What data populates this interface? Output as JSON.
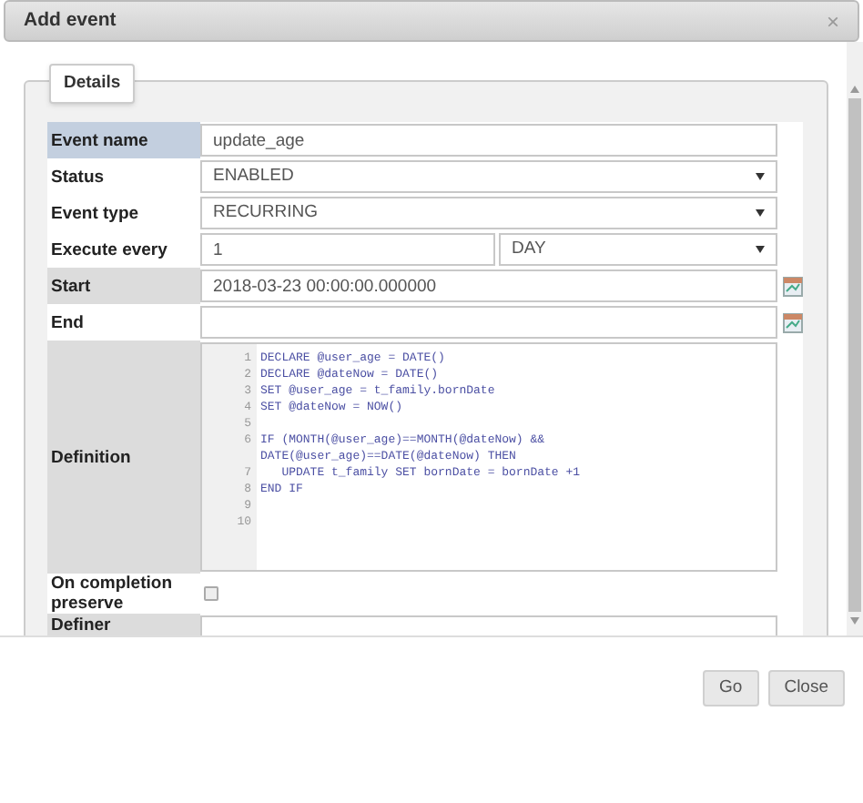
{
  "window": {
    "title": "Add event",
    "close": "×"
  },
  "legend": "Details",
  "rows": [
    {
      "kind": "text",
      "label": "Event name",
      "highlighted": true,
      "shaded": false,
      "value": "update_age"
    },
    {
      "kind": "select",
      "label": "Status",
      "highlighted": false,
      "shaded": false,
      "value": "ENABLED"
    },
    {
      "kind": "select",
      "label": "Event type",
      "highlighted": false,
      "shaded": false,
      "value": "RECURRING"
    },
    {
      "kind": "interval",
      "label": "Execute every",
      "highlighted": false,
      "shaded": false,
      "value": "1",
      "unit": "DAY"
    },
    {
      "kind": "date",
      "label": "Start",
      "highlighted": false,
      "shaded": true,
      "value": "2018-03-23 00:00:00.000000"
    },
    {
      "kind": "date",
      "label": "End",
      "highlighted": false,
      "shaded": false
    },
    {
      "kind": "code",
      "label": "Definition",
      "highlighted": false,
      "shaded": true,
      "lines": [
        {
          "number": "1",
          "text": "DECLARE @user_age = DATE()"
        },
        {
          "number": "2",
          "text": "DECLARE @dateNow = DATE()"
        },
        {
          "number": "3",
          "text": "SET @user_age = t_family.bornDate"
        },
        {
          "number": "4",
          "text": "SET @dateNow = NOW()"
        },
        {
          "number": "5"
        },
        {
          "number": "6",
          "text": "IF (MONTH(@user_age)==MONTH(@dateNow) && DATE(@user_age)==DATE(@dateNow) THEN"
        },
        {
          "number": "7",
          "text": "   UPDATE t_family SET bornDate = bornDate +1"
        },
        {
          "number": "8",
          "text": "END IF"
        },
        {
          "number": "9"
        },
        {
          "number": "10"
        }
      ]
    },
    {
      "kind": "checkbox",
      "label": "On completion preserve",
      "highlighted": false,
      "shaded": false,
      "checked": false
    },
    {
      "kind": "text",
      "label": "Definer",
      "highlighted": false,
      "shaded": true
    }
  ],
  "buttons": [
    "Go",
    "Close"
  ]
}
